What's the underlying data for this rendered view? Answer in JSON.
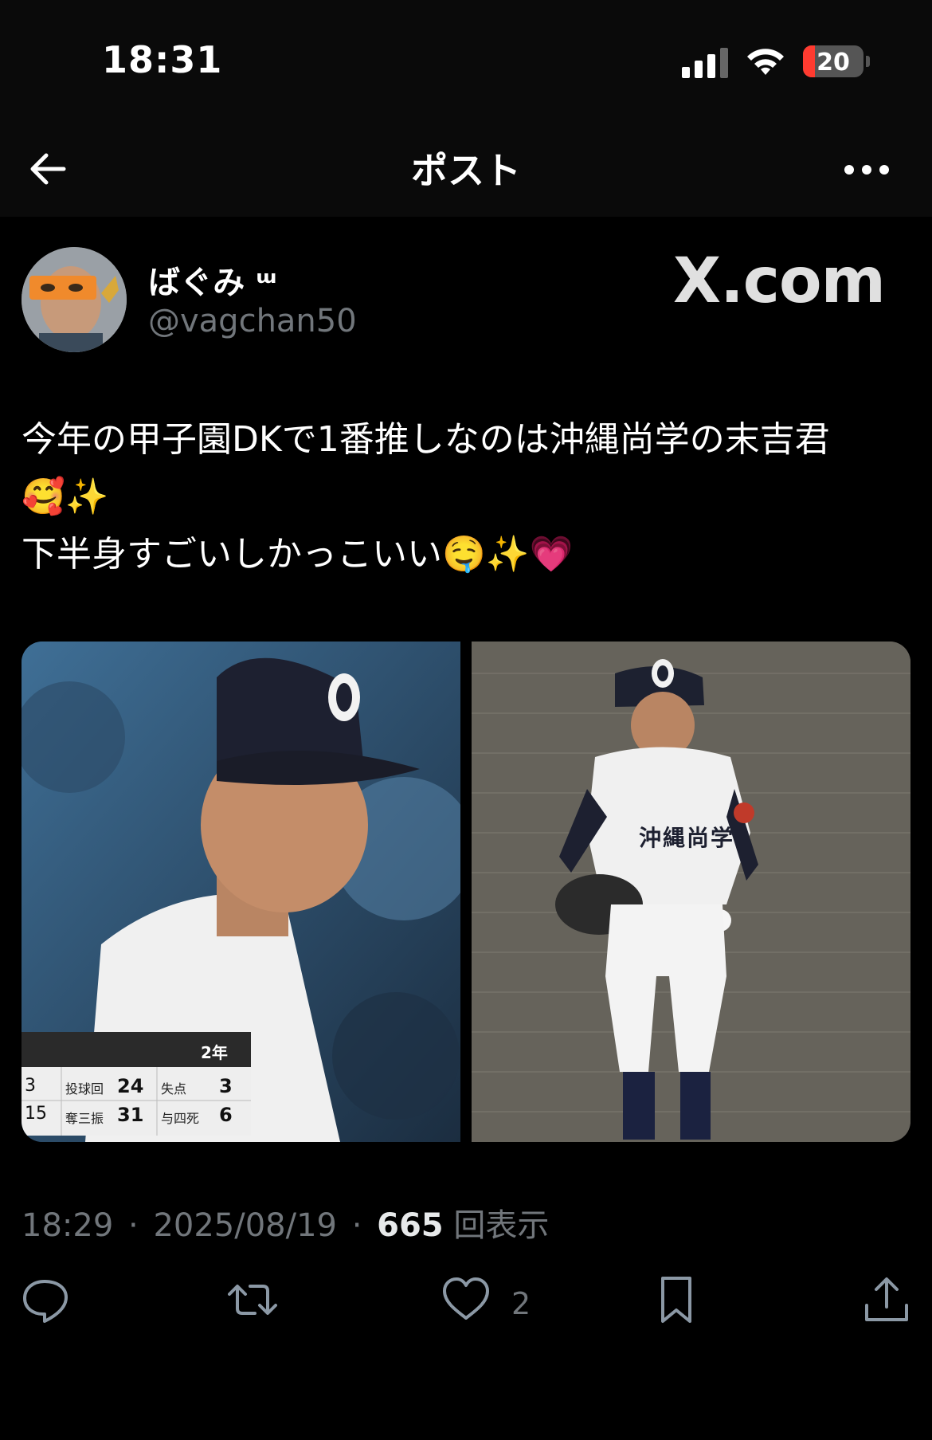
{
  "status_bar": {
    "time": "18:31",
    "battery_percent": "20",
    "battery_level": 0.2,
    "battery_color": "#ff3b30"
  },
  "nav": {
    "title": "ポスト",
    "back_icon": "arrow-left-icon",
    "more_icon": "more-dots-icon"
  },
  "post": {
    "display_name": "ばぐみ ᵚ",
    "handle": "@vagchan50",
    "watermark": "X.com",
    "text_lines": [
      "今年の甲子園DKで1番推しなのは沖縄尚学の末吉君",
      "🥰✨",
      "下半身すごいしかっこいい🤤✨💗"
    ],
    "media": {
      "left_overlay": {
        "grade": "2年",
        "left_nums": [
          "3",
          "15"
        ],
        "labels": [
          "投球回",
          "奪三振",
          "失点",
          "与四死"
        ],
        "values": [
          "24",
          "31",
          "3",
          "6"
        ]
      },
      "right_jersey_text": "沖縄尚学",
      "cap_number": "0"
    },
    "timestamp": "18:29",
    "date": "2025/08/19",
    "separator": "·",
    "views_count": "665",
    "views_label": "回表示"
  },
  "actions": {
    "reply_icon": "reply-icon",
    "repost_icon": "repost-icon",
    "like_icon": "heart-icon",
    "like_count": "2",
    "bookmark_icon": "bookmark-icon",
    "share_icon": "share-icon"
  },
  "colors": {
    "background": "#000000",
    "secondary_text": "#71767b",
    "primary_text": "#e7e9ea"
  }
}
